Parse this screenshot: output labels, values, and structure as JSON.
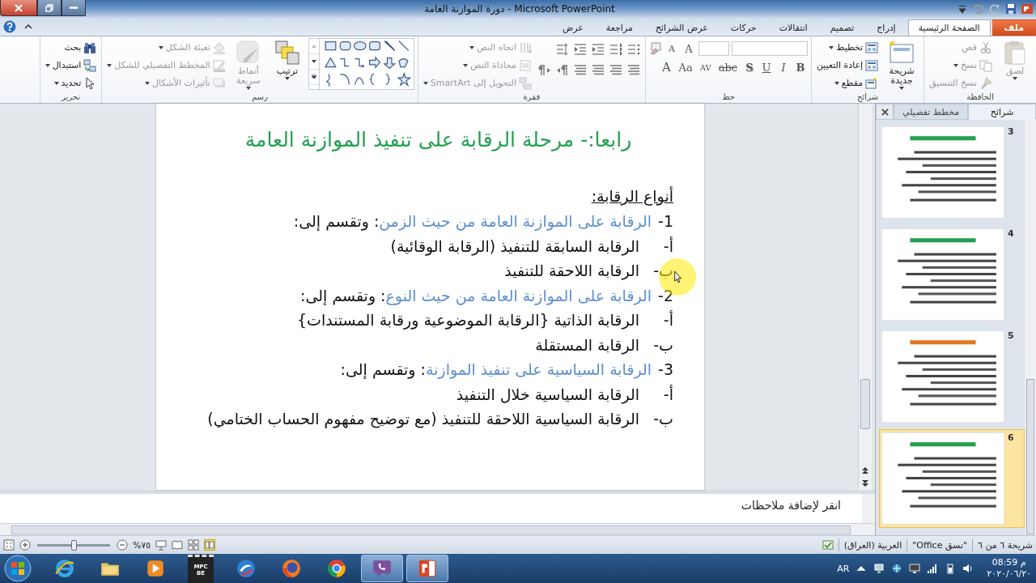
{
  "window": {
    "title": "دورة الموازنة العامة - Microsoft PowerPoint"
  },
  "tabs": [
    {
      "label": "ملف",
      "kind": "file",
      "selected": false
    },
    {
      "label": "الصفحة الرئيسية",
      "kind": "tab",
      "selected": true
    },
    {
      "label": "إدراج",
      "kind": "tab",
      "selected": false
    },
    {
      "label": "تصميم",
      "kind": "tab",
      "selected": false
    },
    {
      "label": "انتقالات",
      "kind": "tab",
      "selected": false
    },
    {
      "label": "حركات",
      "kind": "tab",
      "selected": false
    },
    {
      "label": "عرض الشرائح",
      "kind": "tab",
      "selected": false
    },
    {
      "label": "مراجعة",
      "kind": "tab",
      "selected": false
    },
    {
      "label": "عرض",
      "kind": "tab",
      "selected": false
    }
  ],
  "ribbon": {
    "clipboard": {
      "label": "الحافظة",
      "paste": {
        "label": "لصق",
        "disabled": true,
        "dropdown": true
      },
      "commands": [
        {
          "label": "قص",
          "disabled": true,
          "dropdown": false
        },
        {
          "label": "نسخ",
          "disabled": true,
          "dropdown": true
        },
        {
          "label": "نسخ التنسيق",
          "disabled": true,
          "dropdown": false
        }
      ]
    },
    "slides": {
      "label": "شرائح",
      "new_slide": {
        "label": "شريحة جديدة",
        "disabled": false,
        "dropdown": true
      },
      "commands": [
        {
          "label": "تخطيط",
          "disabled": false,
          "dropdown": true
        },
        {
          "label": "إعادة التعيين",
          "disabled": false,
          "dropdown": false
        },
        {
          "label": "مقطع",
          "disabled": false,
          "dropdown": true
        }
      ]
    },
    "font": {
      "label": "خط",
      "size_buttons": [
        {
          "label": "A"
        },
        {
          "label": "A"
        }
      ],
      "format_buttons": [
        {
          "label": "B"
        },
        {
          "label": "I"
        },
        {
          "label": "U"
        },
        {
          "label": "S"
        },
        {
          "label": "abc"
        },
        {
          "label": "AV"
        },
        {
          "label": "Aa"
        },
        {
          "label": "A"
        }
      ]
    },
    "paragraph": {
      "label": "فقرة",
      "commands": [
        {
          "label": "اتجاه النص",
          "disabled": true,
          "dropdown": true
        },
        {
          "label": "محاذاة النص",
          "disabled": true,
          "dropdown": true
        },
        {
          "label": "التحويل إلى SmartArt",
          "disabled": true,
          "dropdown": true
        }
      ]
    },
    "drawing": {
      "label": "رسم",
      "arrange": {
        "label": "ترتيب",
        "disabled": false,
        "dropdown": true
      },
      "quick_styles": {
        "label": "أنماط سريعة",
        "disabled": true,
        "dropdown": true
      },
      "commands": [
        {
          "label": "تعبئة الشكل",
          "disabled": true,
          "dropdown": true
        },
        {
          "label": "المخطط التفصيلي للشكل",
          "disabled": true,
          "dropdown": true
        },
        {
          "label": "تأثيرات الأشكال",
          "disabled": true,
          "dropdown": true
        }
      ]
    },
    "editing": {
      "label": "تحرير",
      "commands": [
        {
          "label": "بحث",
          "disabled": false,
          "dropdown": false
        },
        {
          "label": "استبدال",
          "disabled": false,
          "dropdown": true
        },
        {
          "label": "تحديد",
          "disabled": false,
          "dropdown": true
        }
      ]
    }
  },
  "slide": {
    "title": "رابعا:- مرحلة الرقابة على تنفيذ الموازنة العامة",
    "heading": "أنواع الرقابة:",
    "lines": [
      {
        "kind": "main",
        "marker": "1-",
        "topic": "الرقابة على الموازنة العامة من حيث الزمن",
        "rest": ": وتقسم إلى:"
      },
      {
        "kind": "sub",
        "marker": "أ-",
        "text": "الرقابة السابقة للتنفيذ (الرقابة الوقائية)"
      },
      {
        "kind": "sub",
        "marker": "ب-",
        "text": "الرقابة اللاحقة للتنفيذ"
      },
      {
        "kind": "main",
        "marker": "2-",
        "topic": "الرقابة على الموازنة العامة من حيث النوع",
        "rest": ": وتقسم إلى:"
      },
      {
        "kind": "sub",
        "marker": "أ-",
        "text": "الرقابة الذاتية {الرقابة الموضوعية ورقابة المستندات}"
      },
      {
        "kind": "sub",
        "marker": "ب-",
        "text": "الرقابة المستقلة"
      },
      {
        "kind": "main",
        "marker": "3-",
        "topic": "الرقابة السياسية على تنفيذ الموازنة",
        "rest": ": وتقسم إلى:"
      },
      {
        "kind": "sub",
        "marker": "أ-",
        "text": "الرقابة السياسية خلال التنفيذ"
      },
      {
        "kind": "sub",
        "marker": "ب-",
        "text": "الرقابة السياسية اللاحقة للتنفيذ (مع توضيح مفهوم الحساب الختامي)"
      }
    ]
  },
  "slide_pane": {
    "tabs": [
      {
        "label": "شرائح",
        "selected": true
      },
      {
        "label": "مخطط تفصيلي",
        "selected": false
      }
    ],
    "thumbnails": [
      {
        "number": "3",
        "color": "#22a050",
        "selected": false
      },
      {
        "number": "4",
        "color": "#22a050",
        "selected": false
      },
      {
        "number": "5",
        "color": "#e07820",
        "selected": false
      },
      {
        "number": "6",
        "color": "#22a050",
        "selected": true
      }
    ]
  },
  "notes": {
    "placeholder": "انقر لإضافة ملاحظات"
  },
  "status_bar": {
    "slide_info": "شريحة ٦ من ٦",
    "theme": "\"نسق Office\"",
    "language": "العربية (العراق)",
    "zoom": {
      "label": "%٧٥",
      "level": 0.5
    }
  },
  "taskbar": {
    "apps": [
      {
        "kind": "ie",
        "active": false
      },
      {
        "kind": "folder",
        "active": false
      },
      {
        "kind": "media",
        "active": false
      },
      {
        "kind": "mpc",
        "text": "MPC BE",
        "active": false
      },
      {
        "kind": "swirl",
        "active": false
      },
      {
        "kind": "firefox",
        "active": false
      },
      {
        "kind": "chrome",
        "active": false
      },
      {
        "kind": "viber",
        "active": true
      },
      {
        "kind": "powerpoint",
        "active": true
      }
    ],
    "language": "AR",
    "time": "08:59 م",
    "date": "٢٠٢٠/٠٦/٢٠"
  }
}
